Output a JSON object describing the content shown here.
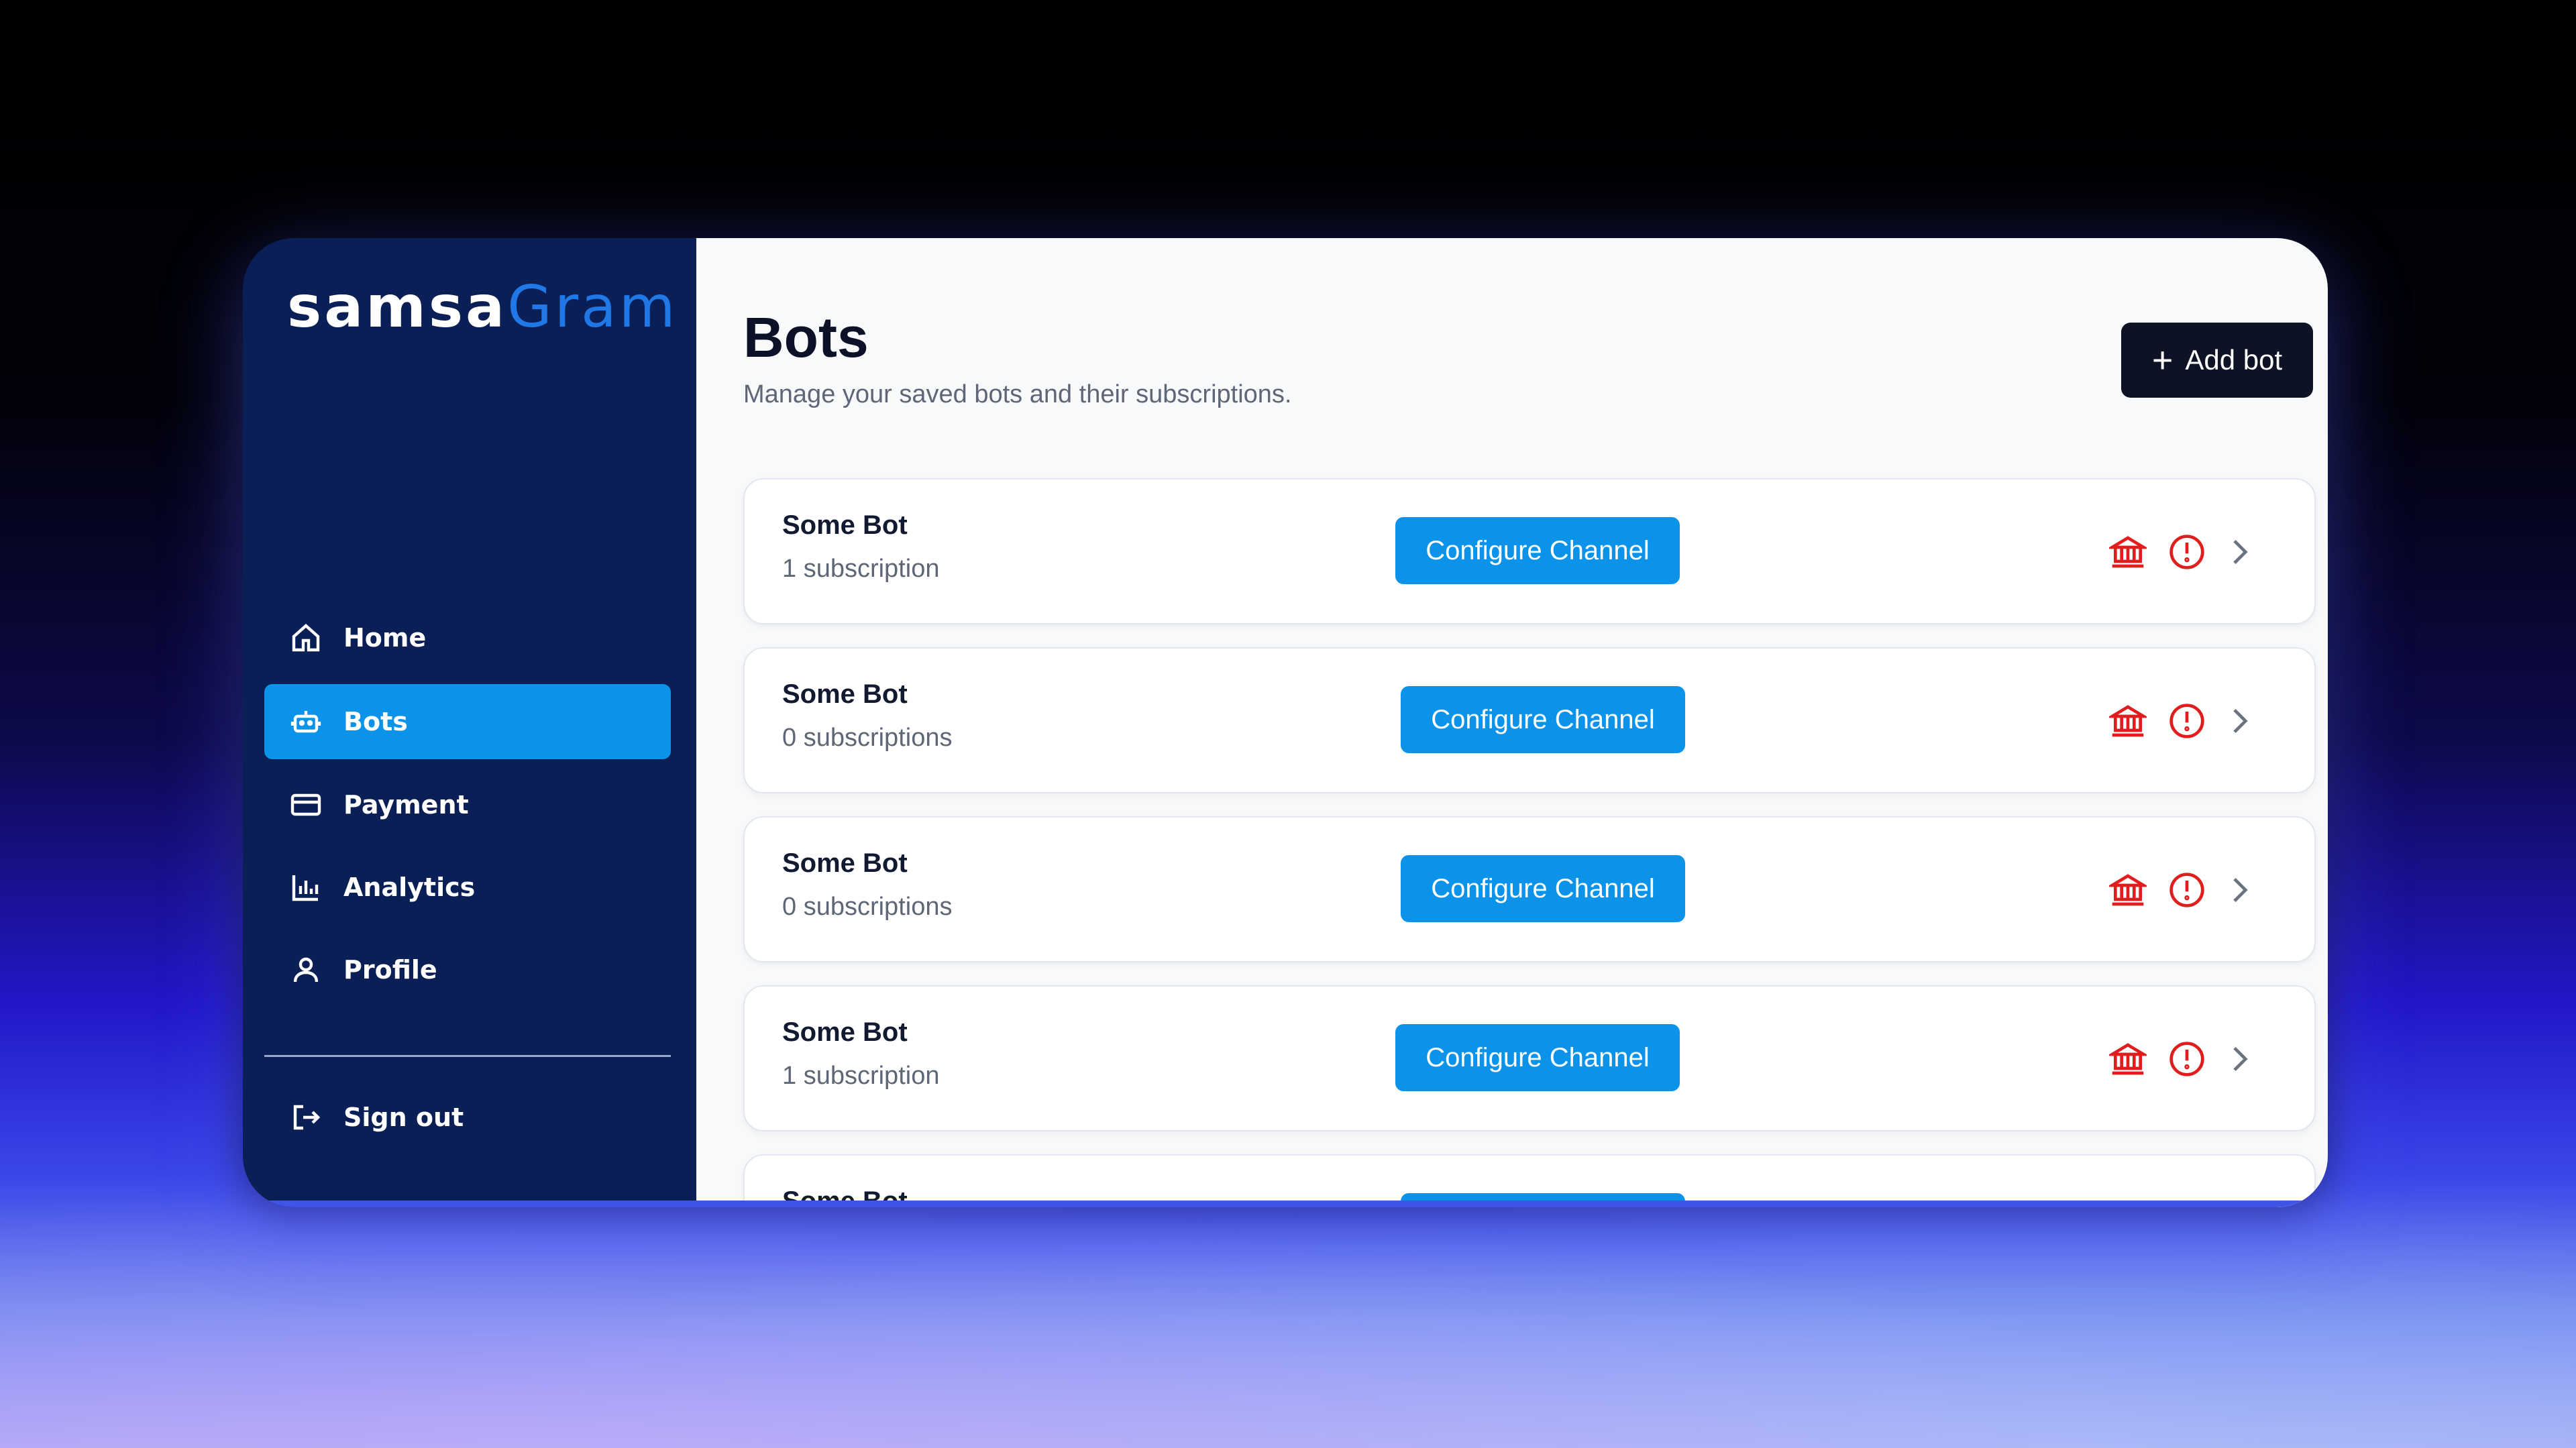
{
  "app": {
    "logo_part1": "samsa",
    "logo_part2": "Gram"
  },
  "sidebar": {
    "items": [
      {
        "label": "Home",
        "icon": "home-icon"
      },
      {
        "label": "Bots",
        "icon": "bot-icon",
        "active": true
      },
      {
        "label": "Payment",
        "icon": "credit-card-icon"
      },
      {
        "label": "Analytics",
        "icon": "bar-chart-icon"
      },
      {
        "label": "Profile",
        "icon": "user-icon"
      }
    ],
    "signout": {
      "label": "Sign out",
      "icon": "sign-out-icon"
    }
  },
  "main": {
    "title": "Bots",
    "subtitle": "Manage your saved bots and their subscriptions.",
    "add_button": {
      "label": "Add bot",
      "icon": "plus-icon"
    },
    "bots": [
      {
        "name": "Some Bot",
        "subs": "1 subscription",
        "cta": "Configure Channel"
      },
      {
        "name": "Some Bot",
        "subs": "0 subscriptions",
        "cta": "Configure Channel"
      },
      {
        "name": "Some Bot",
        "subs": "0 subscriptions",
        "cta": "Configure Channel"
      },
      {
        "name": "Some Bot",
        "subs": "1 subscription",
        "cta": "Configure Channel"
      },
      {
        "name": "Some Bot",
        "subs": "",
        "cta": ""
      }
    ],
    "row_actions": [
      "bank-icon",
      "alert-circle-icon",
      "chevron-right-icon"
    ]
  },
  "colors": {
    "sidebar_bg": "#0b1f57",
    "accent": "#0a93e8",
    "danger": "#e01e1e",
    "dark_button": "#0d1224"
  }
}
